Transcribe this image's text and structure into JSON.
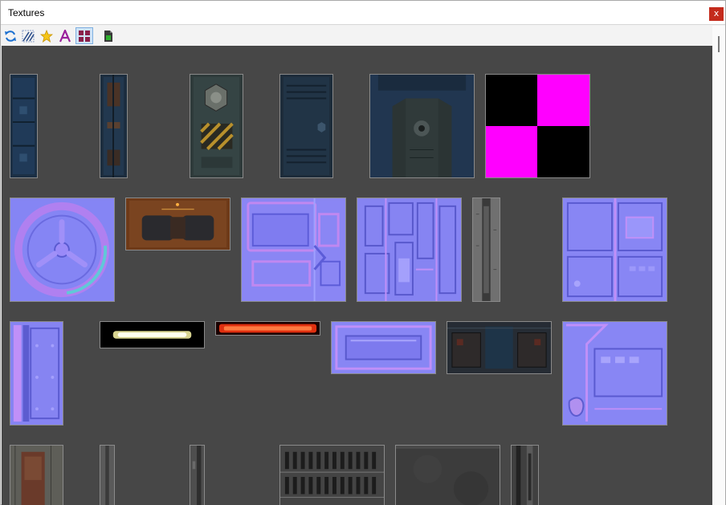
{
  "window": {
    "title": "Textures",
    "close_label": "x"
  },
  "toolbar": {
    "buttons": [
      {
        "name": "refresh-button",
        "icon": "refresh-icon"
      },
      {
        "name": "wireframe-button",
        "icon": "hatch-icon"
      },
      {
        "name": "favorites-button",
        "icon": "star-icon"
      },
      {
        "name": "text-filter-button",
        "icon": "text-a-icon"
      },
      {
        "name": "grid-view-button",
        "icon": "grid-icon",
        "active": true
      },
      {
        "name": "export-button",
        "icon": "document-icon"
      }
    ]
  },
  "textures": [
    {
      "kind": "panel-narrow"
    },
    {
      "kind": "panel-narrow"
    },
    {
      "kind": "door-hazard"
    },
    {
      "kind": "door-panel"
    },
    {
      "kind": "bulkhead"
    },
    {
      "kind": "missing-checker"
    },
    {
      "kind": "normal-wheel"
    },
    {
      "kind": "rust-machine"
    },
    {
      "kind": "normal-panel"
    },
    {
      "kind": "normal-tech"
    },
    {
      "kind": "gray-strip"
    },
    {
      "kind": "normal-panel-b"
    },
    {
      "kind": "normal-column"
    },
    {
      "kind": "light-white"
    },
    {
      "kind": "light-red"
    },
    {
      "kind": "normal-plate"
    },
    {
      "kind": "dark-machine"
    },
    {
      "kind": "normal-panel-c"
    },
    {
      "kind": "rust-door"
    },
    {
      "kind": "gray-thin"
    },
    {
      "kind": "gray-thin-b"
    },
    {
      "kind": "grate"
    },
    {
      "kind": "concrete"
    },
    {
      "kind": "gray-strip-b"
    }
  ]
}
